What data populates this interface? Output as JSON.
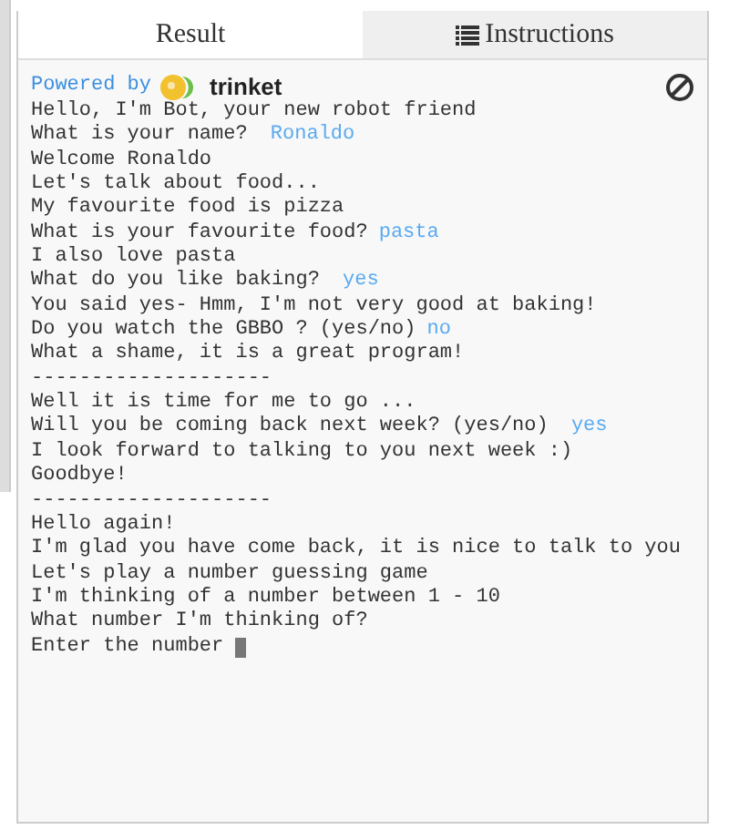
{
  "tabs": [
    {
      "label": "Result",
      "selected": true,
      "kind": "result"
    },
    {
      "label": "Instructions",
      "selected": false,
      "kind": "instructions"
    }
  ],
  "console": {
    "powered_by": "Powered by",
    "brand": "trinket",
    "lines": [
      {
        "text": "Hello, I'm Bot, your new robot friend",
        "cursor": false
      },
      {
        "text": "What is your name? ",
        "reply": "Ronaldo",
        "cursor": false
      },
      {
        "text": "Welcome Ronaldo",
        "cursor": false
      },
      {
        "text": "Let's talk about food...",
        "cursor": false
      },
      {
        "text": "My favourite food is pizza",
        "cursor": false
      },
      {
        "text": "What is your favourite food?",
        "reply": "pasta",
        "cursor": false
      },
      {
        "text": "I also love pasta",
        "cursor": false
      },
      {
        "text": "What do you like baking? ",
        "reply": "yes",
        "cursor": false
      },
      {
        "text": "You said yes- Hmm, I'm not very good at baking!",
        "cursor": false
      },
      {
        "text": "Do you watch the GBBO ? (yes/no)",
        "reply": "no",
        "cursor": false
      },
      {
        "text": "What a shame, it is a great program!",
        "cursor": false
      },
      {
        "text": "--------------------",
        "cursor": false
      },
      {
        "text": "Well it is time for me to go ...",
        "cursor": false
      },
      {
        "text": "Will you be coming back next week? (yes/no) ",
        "reply": "yes",
        "cursor": false
      },
      {
        "text": "I look forward to talking to you next week :)",
        "cursor": false
      },
      {
        "text": "Goodbye!",
        "cursor": false
      },
      {
        "text": "--------------------",
        "cursor": false
      },
      {
        "text": "Hello again!",
        "cursor": false
      },
      {
        "text": "I'm glad you have come back, it is nice to talk to you",
        "cursor": false
      },
      {
        "text": "Let's play a number guessing game",
        "cursor": false
      },
      {
        "text": "I'm thinking of a number between 1 - 10",
        "cursor": false
      },
      {
        "text": "What number I'm thinking of?",
        "cursor": false
      },
      {
        "text": "Enter the number",
        "cursor": true
      }
    ]
  }
}
